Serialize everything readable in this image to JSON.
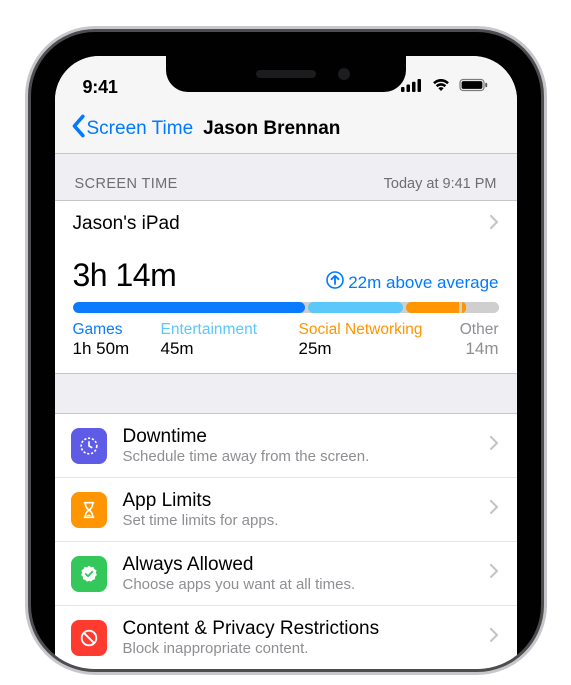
{
  "statusBar": {
    "time": "9:41"
  },
  "nav": {
    "backLabel": "Screen Time",
    "title": "Jason Brennan"
  },
  "sectionHeader": {
    "left": "SCREEN TIME",
    "right": "Today at 9:41 PM"
  },
  "device": {
    "name": "Jason's iPad"
  },
  "summary": {
    "total": "3h 14m",
    "delta": "22m above average",
    "categories": [
      {
        "name": "Games",
        "time": "1h 50m"
      },
      {
        "name": "Entertainment",
        "time": "45m"
      },
      {
        "name": "Social Networking",
        "time": "25m"
      },
      {
        "name": "Other",
        "time": "14m"
      }
    ]
  },
  "options": [
    {
      "title": "Downtime",
      "sub": "Schedule time away from the screen."
    },
    {
      "title": "App Limits",
      "sub": "Set time limits for apps."
    },
    {
      "title": "Always Allowed",
      "sub": "Choose apps you want at all times."
    },
    {
      "title": "Content & Privacy Restrictions",
      "sub": "Block inappropriate content."
    }
  ],
  "chart_data": {
    "type": "bar",
    "title": "Screen Time breakdown",
    "categories": [
      "Games",
      "Entertainment",
      "Social Networking",
      "Other"
    ],
    "values_minutes": [
      110,
      45,
      25,
      14
    ],
    "total_minutes": 194,
    "baseline_delta_minutes": 22,
    "colors": [
      "#0a7bff",
      "#5bc8fa",
      "#ff9500",
      "#cfcfcf"
    ]
  }
}
